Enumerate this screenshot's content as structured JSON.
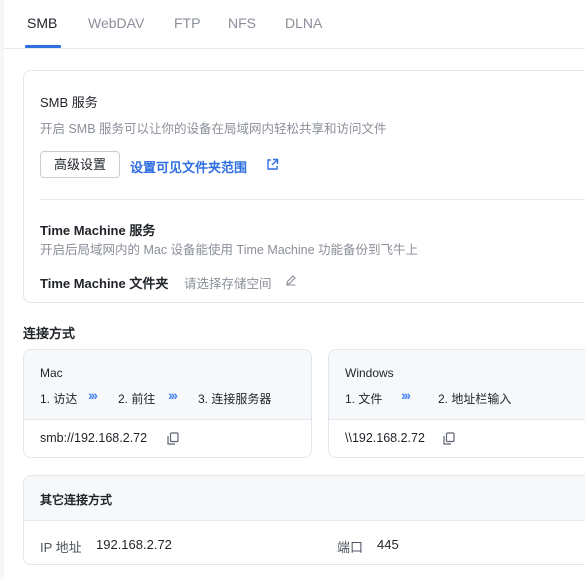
{
  "tabs": [
    {
      "label": "SMB",
      "active": true
    },
    {
      "label": "WebDAV",
      "active": false
    },
    {
      "label": "FTP",
      "active": false
    },
    {
      "label": "NFS",
      "active": false
    },
    {
      "label": "DLNA",
      "active": false
    }
  ],
  "smb": {
    "title": "SMB 服务",
    "description": "开启 SMB 服务可以让你的设备在局域网内轻松共享和访问文件",
    "advanced_button": "高级设置",
    "folder_scope_link": "设置可见文件夹范围"
  },
  "time_machine": {
    "title": "Time Machine 服务",
    "description": "开启后局域网内的 Mac 设备能使用 Time Machine 功能备份到飞牛上",
    "folder_label": "Time Machine 文件夹",
    "folder_placeholder": "请选择存储空间"
  },
  "connection": {
    "section_title": "连接方式",
    "mac": {
      "name": "Mac",
      "steps": [
        "1. 访达",
        "2. 前往",
        "3. 连接服务器"
      ],
      "address": "smb://192.168.2.72"
    },
    "windows": {
      "name": "Windows",
      "steps": [
        "1. 文件",
        "2. 地址栏输入"
      ],
      "address": "\\\\192.168.2.72"
    },
    "other": {
      "title": "其它连接方式",
      "ip_label": "IP 地址",
      "ip_value": "192.168.2.72",
      "port_label": "端口",
      "port_value": "445"
    }
  },
  "colors": {
    "accent": "#2f6fe0",
    "chevron": "#4a85f0",
    "muted": "#8a8f99"
  },
  "icons": [
    "external-link-icon",
    "edit-pencil-icon",
    "copy-icon",
    "chevron-right-icon"
  ]
}
